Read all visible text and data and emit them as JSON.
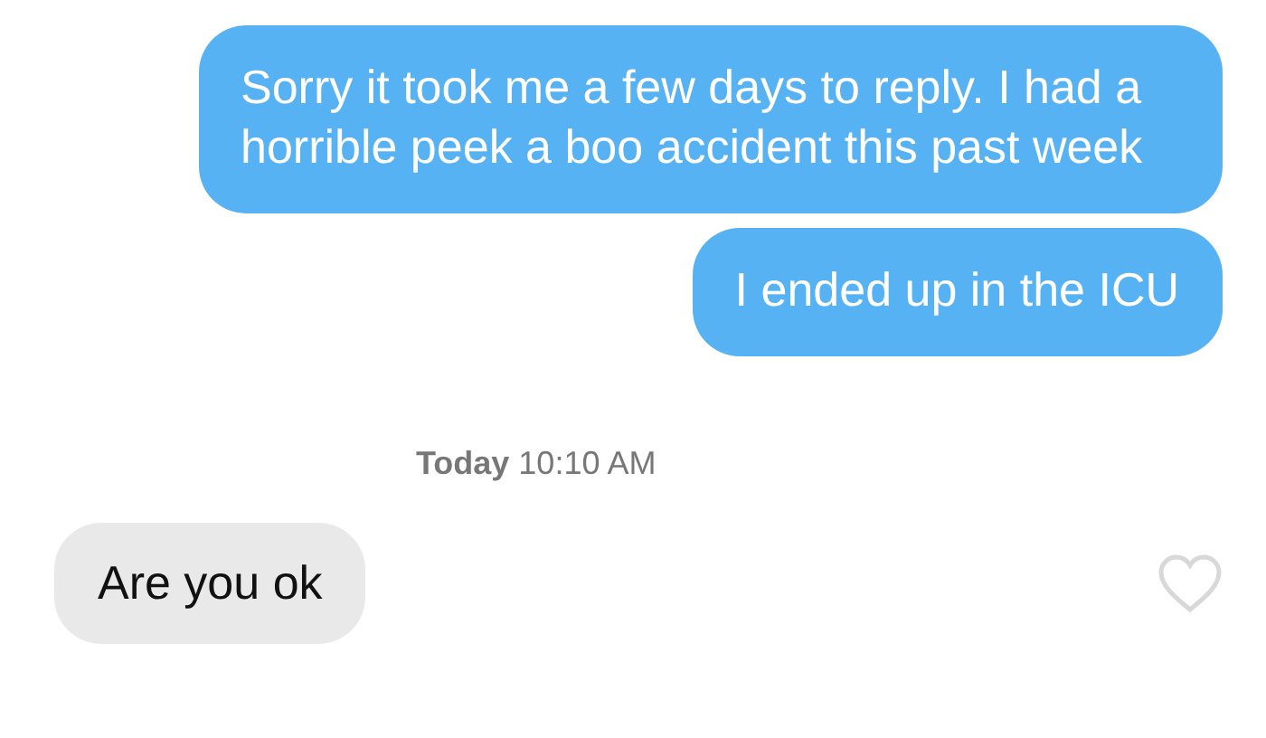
{
  "messages": [
    {
      "kind": "sent",
      "text": "Sorry it took me a few days to reply. I had a horrible peek a boo accident this past week"
    },
    {
      "kind": "sent",
      "text": "I ended up in the ICU"
    },
    {
      "kind": "timestamp",
      "text": "**Today** 10:10 AM"
    },
    {
      "kind": "received",
      "text": "Are you ok",
      "liked": false
    }
  ]
}
